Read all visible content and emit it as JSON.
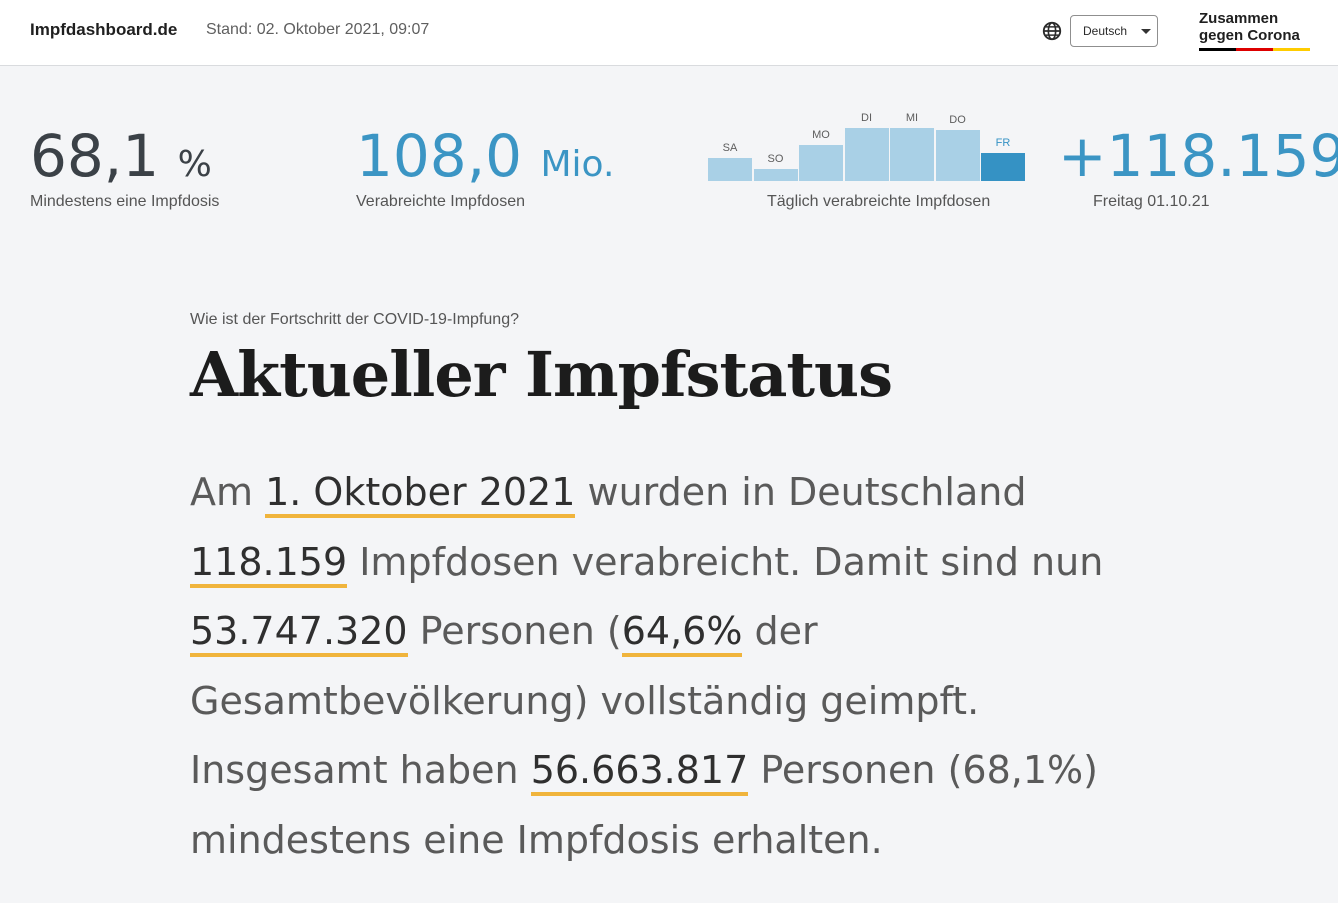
{
  "header": {
    "brand": "Impfdashboard.de",
    "stand": "Stand: 02. Oktober 2021, 09:07",
    "language": "Deutsch",
    "logo_line1": "Zusammen",
    "logo_line2": "gegen Corona",
    "icons": [
      "globe-icon",
      "chevron-down-icon"
    ]
  },
  "stats": {
    "first_dose_value": "68,1",
    "first_dose_unit": "%",
    "first_dose_label": "Mindestens eine Impfdosis",
    "doses_value": "108,0",
    "doses_unit": "Mio.",
    "doses_label": "Verabreichte Impfdosen",
    "daily_label": "Täglich verabreichte Impfdosen",
    "daily_value": "+118.159",
    "daily_date": "Freitag 01.10.21"
  },
  "colors": {
    "accent_blue": "#3b95c4",
    "bar_light": "#a9d0e6",
    "bar_active": "#3592c4",
    "underline": "#f0b43c",
    "logo_black": "#000000",
    "logo_red": "#dd0000",
    "logo_gold": "#ffcc00"
  },
  "chart_data": {
    "type": "bar",
    "categories": [
      "SA",
      "SO",
      "MO",
      "DI",
      "MI",
      "DO",
      "FR"
    ],
    "values": [
      0.31,
      0.17,
      0.5,
      0.73,
      0.73,
      0.7,
      0.39
    ],
    "highlighted": "FR",
    "xlabel": "Täglich verabreichte Impfdosen",
    "ylabel": "",
    "note": "relative bar heights"
  },
  "main": {
    "question": "Wie ist der Fortschritt der COVID-19-Impfung?",
    "title": "Aktueller Impfstatus",
    "t1": "Am ",
    "date": "1. Oktober 2021",
    "t2": " wurden in Deutschland ",
    "doses": "118.159",
    "t3": " Impfdosen verabreicht. Damit sind nun ",
    "full": "53.747.320",
    "t4": " Personen (",
    "full_pct": "64,6%",
    "t5": " der Gesamtbevölkerung) vollständig geimpft. Insgesamt haben ",
    "one": "56.663.817",
    "t6": " Personen (68,1%) mindestens eine Impfdosis erhalten."
  }
}
